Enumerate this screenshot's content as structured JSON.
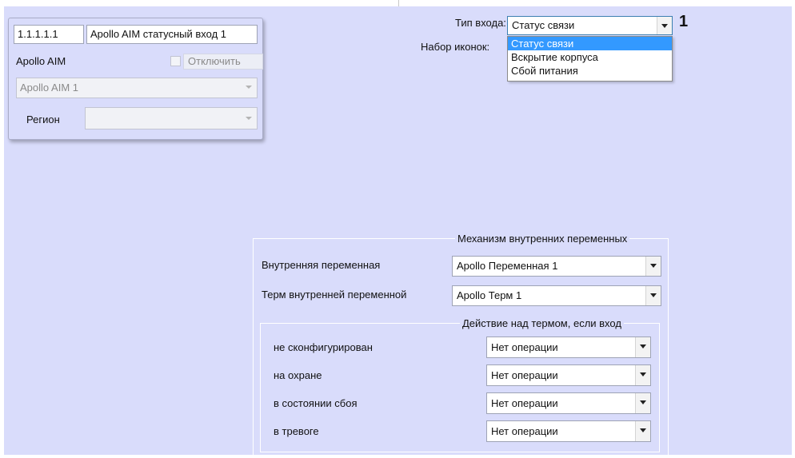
{
  "device_card": {
    "address": "1.1.1.1.1",
    "name": "Apollo AIM статусный вход 1",
    "parent_label": "Apollo AIM",
    "disable_label": "Отключить",
    "parent_device": "Apollo AIM 1",
    "region_label": "Регион",
    "region_value": ""
  },
  "input_type": {
    "label": "Тип входа:",
    "selected": "Статус связи",
    "options": [
      "Статус связи",
      "Вскрытие корпуса",
      "Сбой питания"
    ],
    "callout": "1"
  },
  "icon_set": {
    "label": "Набор иконок:"
  },
  "internal_vars": {
    "title": "Механизм внутренних переменных",
    "variable_label": "Внутренняя переменная",
    "variable_value": "Apollo Переменная 1",
    "term_label": "Терм внутренней переменной",
    "term_value": "Apollo Терм 1"
  },
  "term_action": {
    "title": "Действие над термом, если вход",
    "rows": [
      {
        "label": "не сконфигурирован",
        "value": "Нет операции"
      },
      {
        "label": "на охране",
        "value": "Нет операции"
      },
      {
        "label": "в состоянии сбоя",
        "value": "Нет операции"
      },
      {
        "label": "в тревоге",
        "value": "Нет операции"
      }
    ]
  },
  "colors": {
    "panel_bg": "#d9dcfb",
    "selection": "#3399ff",
    "focus_border": "#3c7fb1"
  }
}
